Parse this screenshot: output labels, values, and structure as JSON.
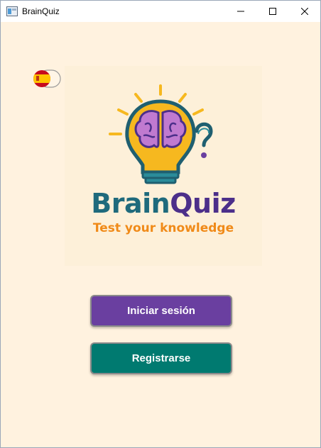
{
  "window": {
    "title": "BrainQuiz",
    "controls": [
      "minimize",
      "maximize",
      "close"
    ]
  },
  "language_toggle": {
    "flag": "spain-flag-icon",
    "state": "off"
  },
  "logo": {
    "brand_part1": "Brain",
    "brand_part2": "Quiz",
    "tagline": "Test your knowledge",
    "colors": {
      "brain_teal": "#1f6a7c",
      "quiz_purple": "#4c2f8a",
      "tagline_orange": "#f08a18",
      "bulb_yellow": "#f6b81f",
      "brain_pink": "#c07ad0"
    }
  },
  "buttons": {
    "login_label": "Iniciar sesión",
    "register_label": "Registrarse",
    "login_color": "#6a3fa0",
    "register_color": "#007a70"
  },
  "background_color": "#fff2df"
}
